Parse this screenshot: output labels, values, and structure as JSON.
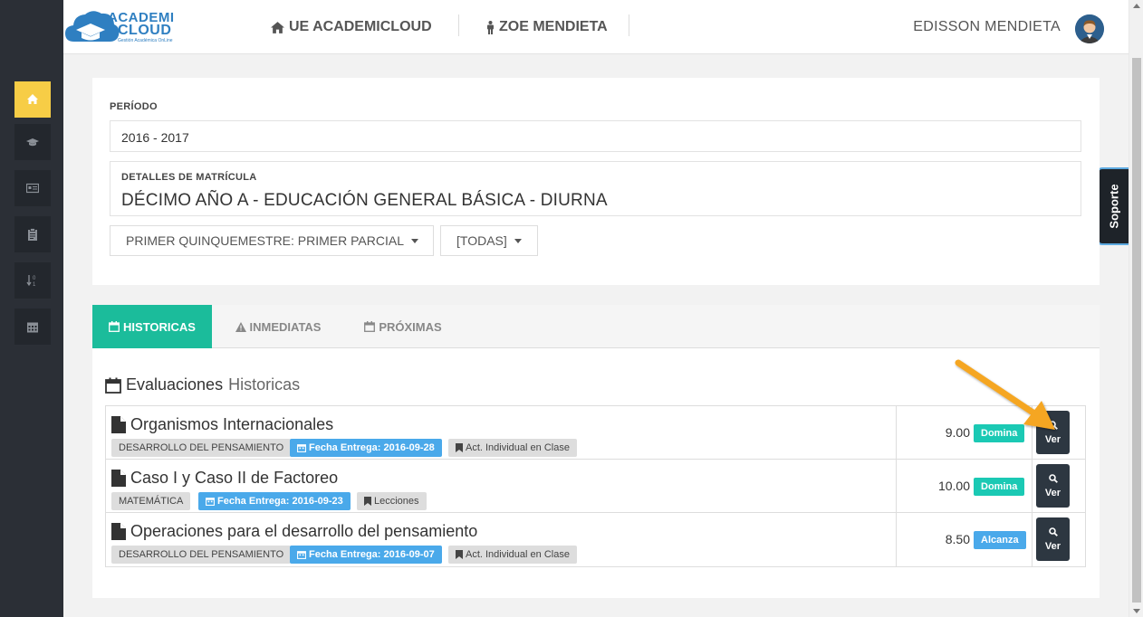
{
  "header": {
    "logo_line1": "ACADEMI",
    "logo_line2": "CLOUD",
    "logo_tagline": "Gestión Académica OnLine",
    "institution": "UE ACADEMICLOUD",
    "student": "ZOE MENDIETA",
    "user_name": "EDISSON MENDIETA"
  },
  "sidebar": {
    "items": [
      {
        "icon": "home-icon",
        "active": true
      },
      {
        "icon": "graduation-cap-icon",
        "active": false
      },
      {
        "icon": "id-card-icon",
        "active": false
      },
      {
        "icon": "clipboard-icon",
        "active": false
      },
      {
        "icon": "sort-numeric-icon",
        "active": false
      },
      {
        "icon": "calendar-icon",
        "active": false
      }
    ]
  },
  "support_tab": "Soporte",
  "filters": {
    "period_label": "PERÍODO",
    "period_value": "2016 - 2017",
    "details_label": "DETALLES DE MATRÍCULA",
    "details_value": "DÉCIMO AÑO A - EDUCACIÓN GENERAL BÁSICA - DIURNA",
    "partial_select": "PRIMER QUINQUEMESTRE: PRIMER PARCIAL",
    "type_select": "[TODAS]"
  },
  "tabs": [
    {
      "label": "HISTORICAS",
      "active": true
    },
    {
      "label": "INMEDIATAS",
      "active": false
    },
    {
      "label": "PRÓXIMAS",
      "active": false
    }
  ],
  "section": {
    "title_main": "Evaluaciones",
    "title_light": "Historicas"
  },
  "evaluations": [
    {
      "name": "Organismos Internacionales",
      "subject": "DESARROLLO DEL PENSAMIENTO",
      "due_date": "Fecha Entrega: 2016-09-28",
      "type": "Act. Individual en Clase",
      "score": "9.00",
      "status": "Domina",
      "status_color": "#1bc9b4",
      "action": "Ver"
    },
    {
      "name": "Caso I y Caso II de Factoreo",
      "subject": "MATEMÁTICA",
      "due_date": "Fecha Entrega: 2016-09-23",
      "type": "Lecciones",
      "score": "10.00",
      "status": "Domina",
      "status_color": "#1bc9b4",
      "action": "Ver"
    },
    {
      "name": "Operaciones para el desarrollo del pensamiento",
      "subject": "DESARROLLO DEL PENSAMIENTO",
      "due_date": "Fecha Entrega: 2016-09-07",
      "type": "Act. Individual en Clase",
      "score": "8.50",
      "status": "Alcanza",
      "status_color": "#4aa9ea",
      "action": "Ver"
    }
  ],
  "colors": {
    "sidebar_bg": "#2b2f36",
    "sidebar_active": "#f7cd46",
    "tab_active": "#1bbc9b",
    "date_badge": "#4aa9ea",
    "annotation_arrow": "#f5a623"
  }
}
